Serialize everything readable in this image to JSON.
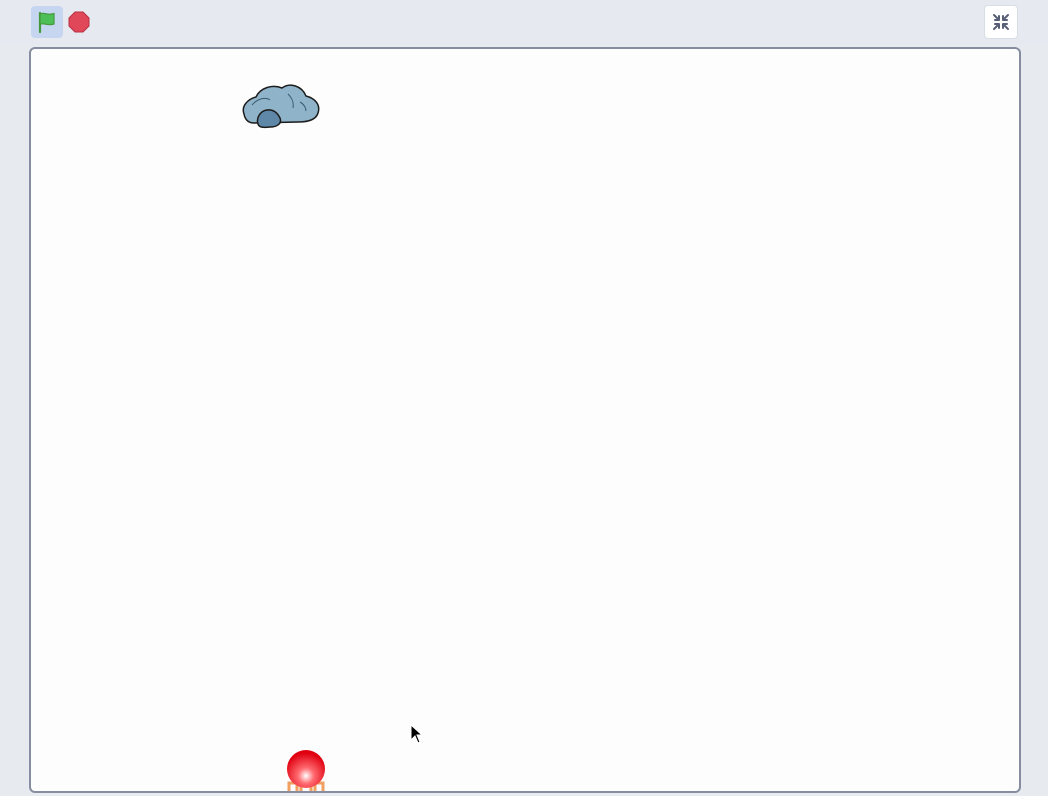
{
  "toolbar": {
    "green_flag": "green-flag-icon",
    "stop": "stop-sign-icon",
    "fullscreen": "exit-fullscreen-icon"
  },
  "stage": {
    "sprites": [
      {
        "name": "rock",
        "icon": "rock-icon"
      },
      {
        "name": "ball",
        "icon": "ball-icon"
      }
    ]
  },
  "colors": {
    "flag_green": "#4cbf56",
    "stop_red": "#e0485a",
    "ball_red": "#e00010",
    "rock_blue": "#8fb3c9",
    "stage_border": "#868da0"
  }
}
